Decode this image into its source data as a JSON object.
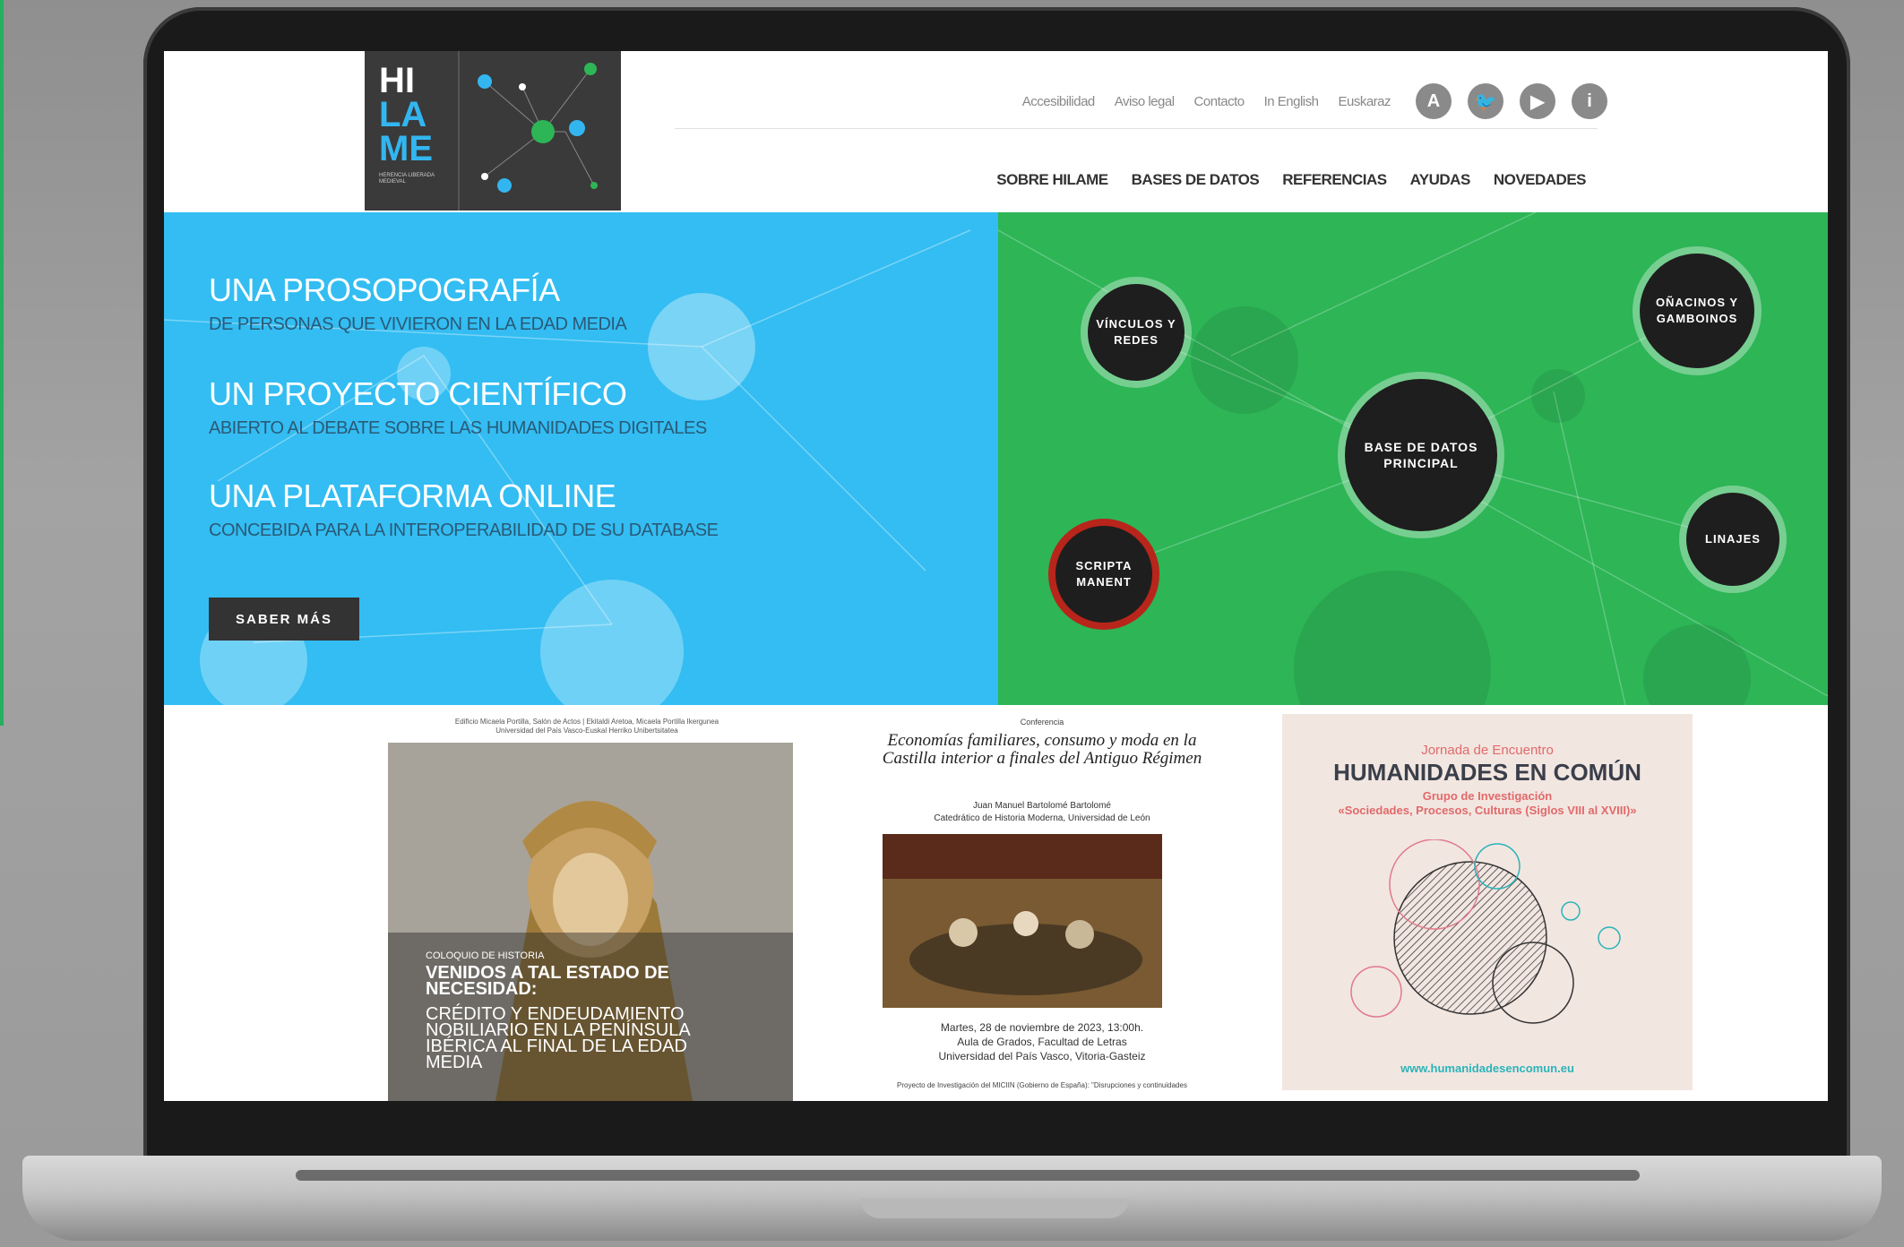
{
  "colors": {
    "blue": "#33bdf2",
    "green": "#2db556",
    "dark": "#1e1e1e",
    "red_ring": "#b8251b"
  },
  "logo": {
    "line1": "HI",
    "line2": "LA",
    "line3": "ME",
    "subtitle": "HERENCIA LIBERADA MEDIEVAL"
  },
  "top_links": [
    "Accesibilidad",
    "Aviso legal",
    "Contacto",
    "In English",
    "Euskaraz"
  ],
  "social_icons": [
    {
      "name": "accessibility-icon",
      "glyph": "A"
    },
    {
      "name": "twitter-icon",
      "glyph": "🐦"
    },
    {
      "name": "youtube-icon",
      "glyph": "▶"
    },
    {
      "name": "info-icon",
      "glyph": "i"
    }
  ],
  "main_nav": [
    "SOBRE HILAME",
    "BASES DE DATOS",
    "REFERENCIAS",
    "AYUDAS",
    "NOVEDADES"
  ],
  "hero": {
    "taglines": [
      {
        "main": "UNA PROSOPOGRAFÍA",
        "sub": "DE PERSONAS QUE VIVIERON EN LA EDAD MEDIA"
      },
      {
        "main": "UN PROYECTO CIENTÍFICO",
        "sub": "ABIERTO AL DEBATE SOBRE LAS HUMANIDADES DIGITALES"
      },
      {
        "main": "UNA PLATAFORMA ONLINE",
        "sub": "CONCEBIDA PARA LA INTEROPERABILIDAD DE SU DATABASE"
      }
    ],
    "button": "SABER MÁS",
    "bubbles": [
      {
        "id": "vinculos",
        "label": "VÍNCULOS Y REDES"
      },
      {
        "id": "cambios",
        "label": "OÑACINOS Y GAMBOINOS"
      },
      {
        "id": "base",
        "label": "BASE DE DATOS PRINCIPAL"
      },
      {
        "id": "linajes",
        "label": "LINAJES"
      },
      {
        "id": "scripta",
        "label": "SCRIPTA MANENT"
      }
    ]
  },
  "cards": {
    "coloquio": {
      "header": "Edificio Micaela Portilla, Salón de Actos | Ekitaldi Aretoa, Micaela Portilla Ikergunea\nUniversidad del País Vasco-Euskal Herriko Unibertsitatea",
      "small": "COLOQUIO DE HISTORIA",
      "title": "VENIDOS A TAL ESTADO DE NECESIDAD:",
      "body": "CRÉDITO Y ENDEUDAMIENTO NOBILIARIO EN LA PENÍNSULA IBÉRICA AL FINAL DE LA EDAD MEDIA"
    },
    "conferencia": {
      "label": "Conferencia",
      "title": "Economías familiares, consumo y moda en la Castilla interior a finales del Antiguo Régimen",
      "author": "Juan Manuel Bartolomé Bartolomé",
      "affiliation": "Catedrático de Historia Moderna, Universidad de León",
      "date": "Martes, 28 de noviembre de 2023, 13:00h.",
      "place": "Aula de Grados, Facultad de Letras",
      "univ": "Universidad del País Vasco, Vitoria-Gasteiz",
      "footer": "Proyecto de Investigación del MICIIN (Gobierno de España): \"Disrupciones y continuidades"
    },
    "jornada": {
      "pre": "Jornada de Encuentro",
      "title": "HUMANIDADES EN COMÚN",
      "group": "Grupo de Investigación",
      "line": "«Sociedades, Procesos, Culturas (Siglos VIII al XVIII)»",
      "url": "www.humanidadesencomun.eu"
    }
  }
}
